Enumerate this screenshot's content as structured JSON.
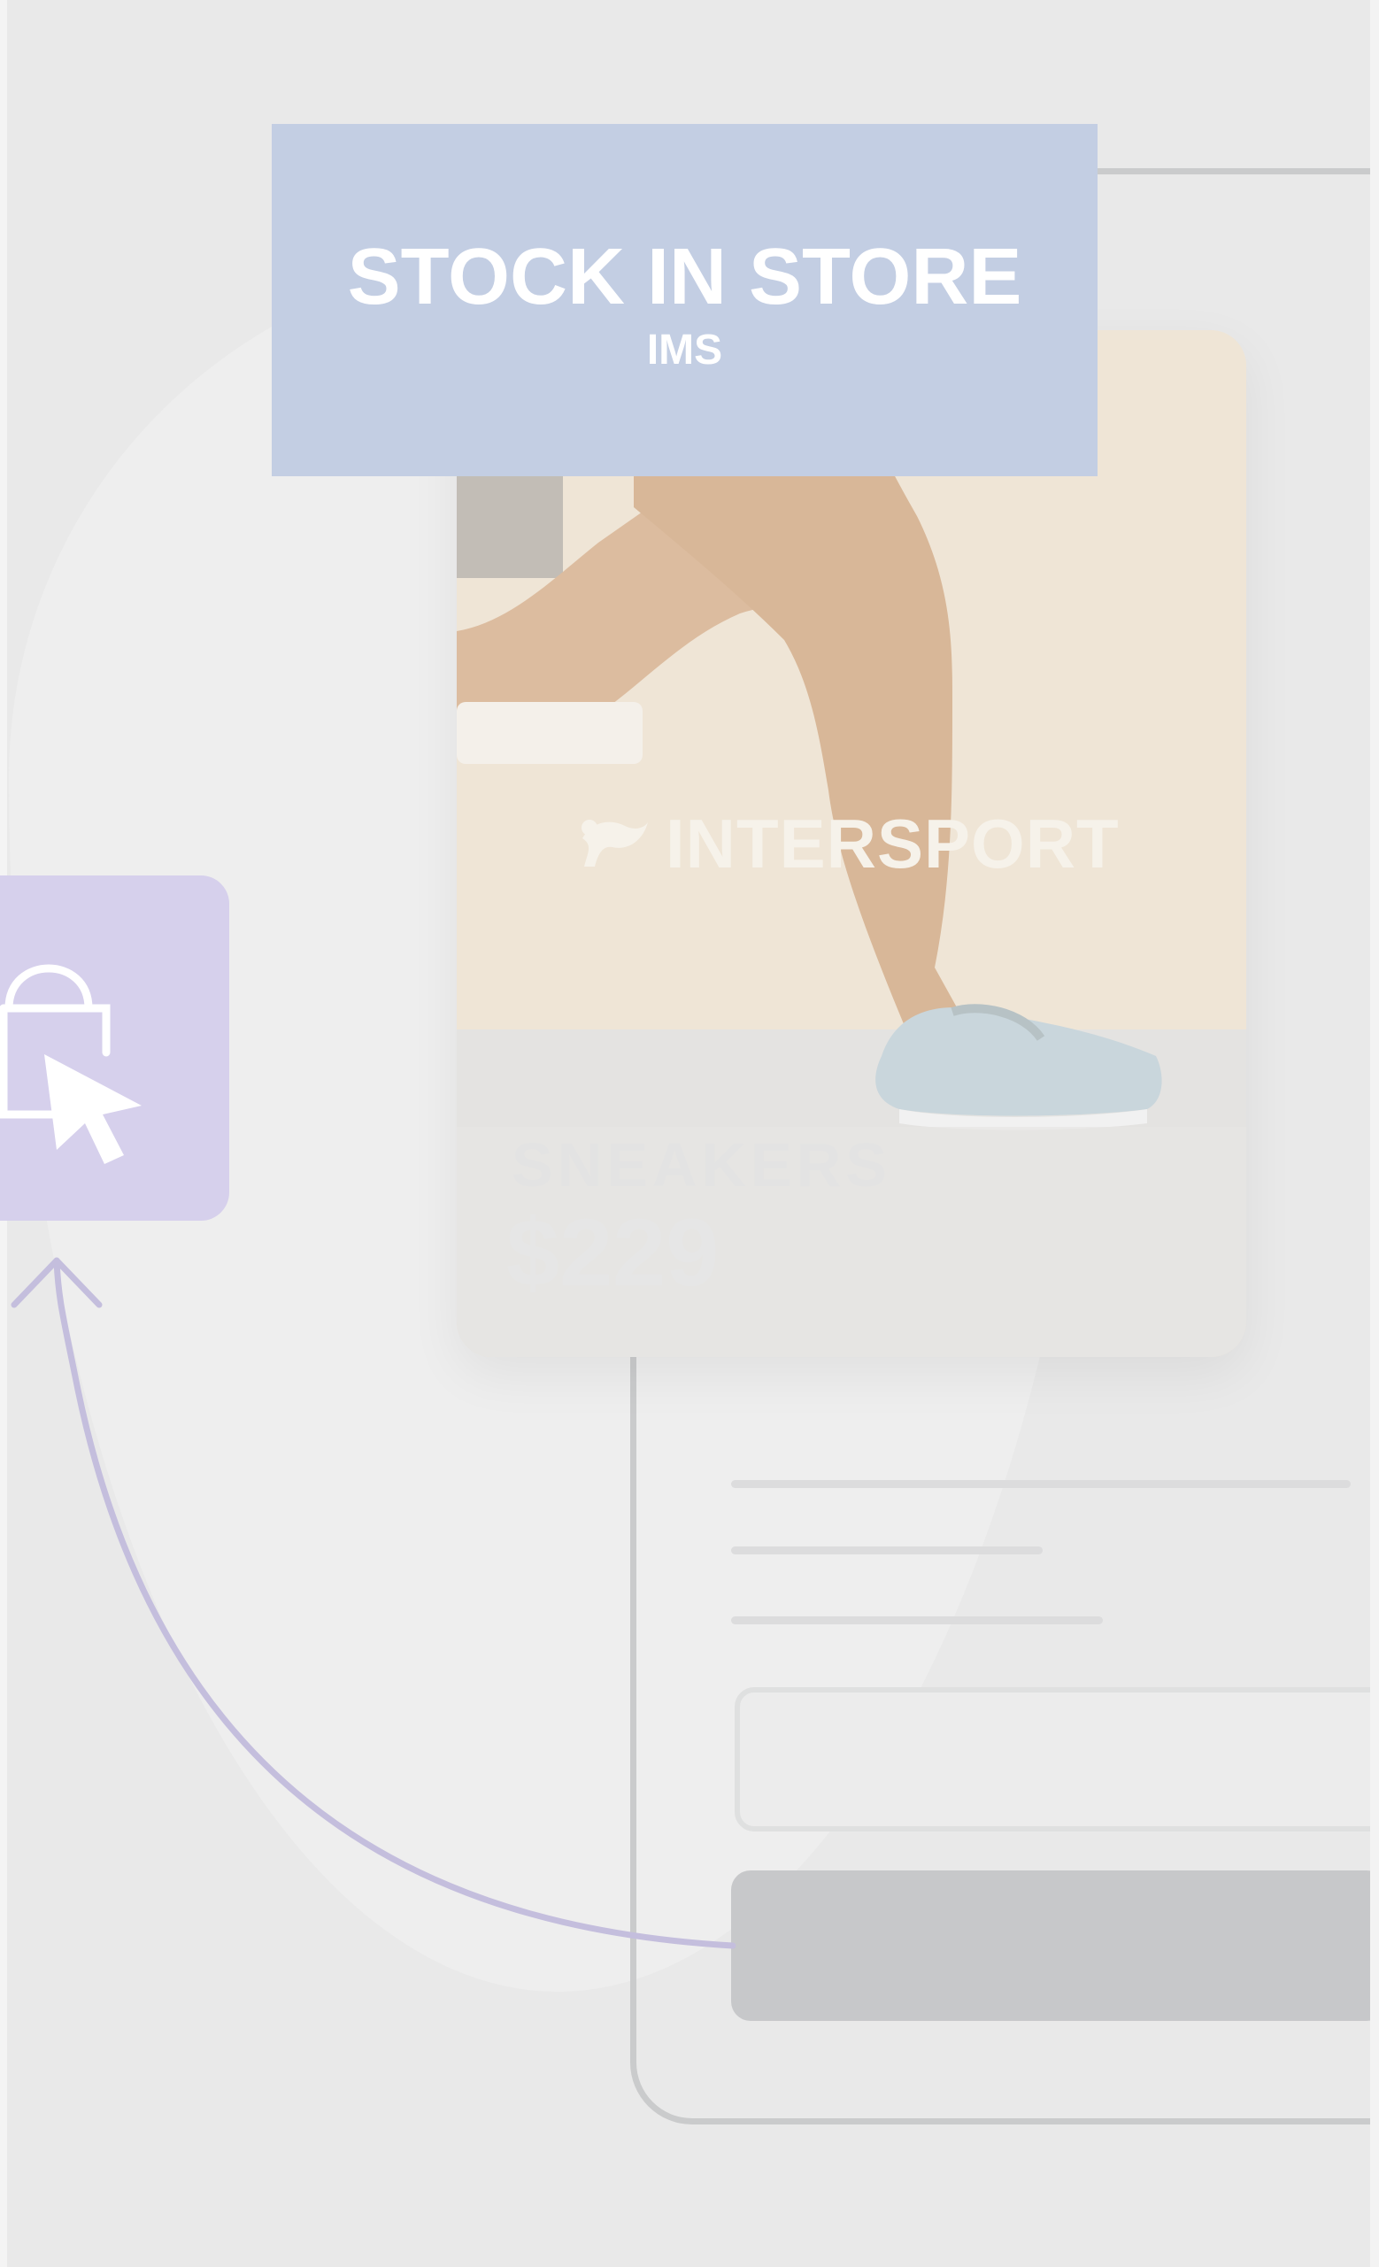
{
  "banner": {
    "title": "STOCK IN STORE",
    "subtitle": "IMS"
  },
  "product_card": {
    "brand": "INTERSPORT",
    "category": "SNEAKERS",
    "price": "$229"
  },
  "icons": {
    "cart": "shopping-bag-cursor-icon",
    "brand": "intersport-logo-icon",
    "connector": "arrow-up-icon"
  },
  "colors": {
    "banner_bg": "#c3cee3",
    "cart_tile_bg": "#d6d0ec",
    "card_bg": "#efe6d9",
    "connector": "#c4bedd",
    "button": "#c7c8ca"
  }
}
